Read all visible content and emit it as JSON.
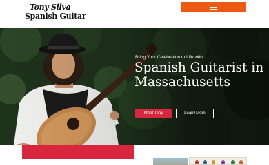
{
  "header": {
    "logo_line1": "Tony Silva",
    "logo_line2": "Spanish Guitar",
    "menu_icon": "hamburger-icon",
    "menu_color": "#ee5a13"
  },
  "hero": {
    "eyebrow": "Bring Your Celebration to Life with",
    "headline": "Spanish Guitarist in Massachusetts",
    "primary_button": "Meet Tony",
    "secondary_button": "Learn More",
    "primary_color": "#d7263d"
  },
  "colors": {
    "accent_red": "#d7263d",
    "accent_orange": "#ee5a13",
    "foliage": "#1c2e19"
  }
}
